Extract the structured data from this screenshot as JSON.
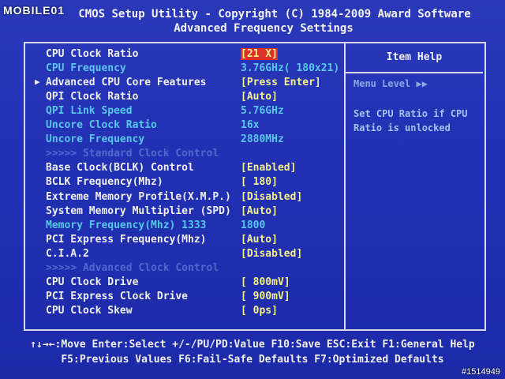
{
  "watermark": "MOBILE01",
  "header": {
    "title": "CMOS Setup Utility - Copyright (C) 1984-2009 Award Software",
    "subtitle": "Advanced Frequency Settings"
  },
  "rows": [
    {
      "label": "CPU Clock Ratio",
      "value": "[21 X]",
      "label_color": "white",
      "value_color": "yellow",
      "highlight": true
    },
    {
      "label": "CPU Frequency",
      "value": "3.76GHz( 180x21)",
      "label_color": "cyan",
      "value_color": "cyan"
    },
    {
      "label": "Advanced CPU Core Features",
      "value": "[Press Enter]",
      "label_color": "white",
      "value_color": "yellow",
      "arrow": true
    },
    {
      "label": "QPI Clock Ratio",
      "value": "[Auto]",
      "label_color": "white",
      "value_color": "yellow"
    },
    {
      "label": "QPI Link Speed",
      "value": "5.76GHz",
      "label_color": "cyan",
      "value_color": "cyan"
    },
    {
      "label": "Uncore Clock Ratio",
      "value": "16x",
      "label_color": "cyan",
      "value_color": "cyan"
    },
    {
      "label": "Uncore Frequency",
      "value": "2880MHz",
      "label_color": "cyan",
      "value_color": "cyan"
    },
    {
      "label": ">>>>>  Standard Clock Control",
      "value": "",
      "label_color": "dim",
      "value_color": "dim"
    },
    {
      "label": "Base Clock(BCLK) Control",
      "value": "[Enabled]",
      "label_color": "white",
      "value_color": "yellow"
    },
    {
      "label": "BCLK Frequency(Mhz)",
      "value": "[ 180]",
      "label_color": "white",
      "value_color": "yellow"
    },
    {
      "label": "Extreme Memory Profile(X.M.P.)",
      "value": "[Disabled]",
      "label_color": "white",
      "value_color": "yellow"
    },
    {
      "label": "System Memory Multiplier (SPD)",
      "value": "[Auto]",
      "label_color": "white",
      "value_color": "yellow"
    },
    {
      "label": "Memory Frequency(Mhz)    1333",
      "value": "1800",
      "label_color": "cyan",
      "value_color": "cyan"
    },
    {
      "label": "PCI Express Frequency(Mhz)",
      "value": "[Auto]",
      "label_color": "white",
      "value_color": "yellow"
    },
    {
      "label": "C.I.A.2",
      "value": "[Disabled]",
      "label_color": "white",
      "value_color": "yellow"
    },
    {
      "label": ">>>>>  Advanced Clock Control",
      "value": "",
      "label_color": "dim",
      "value_color": "dim"
    },
    {
      "label": "CPU Clock Drive",
      "value": "[ 800mV]",
      "label_color": "white",
      "value_color": "yellow"
    },
    {
      "label": "PCI Express Clock Drive",
      "value": "[ 900mV]",
      "label_color": "white",
      "value_color": "yellow"
    },
    {
      "label": "CPU Clock Skew",
      "value": "[   0ps]",
      "label_color": "white",
      "value_color": "yellow"
    }
  ],
  "help": {
    "title": "Item Help",
    "menu_level": "Menu Level   ▶▶",
    "lines": [
      "Set CPU Ratio if CPU",
      "Ratio is unlocked"
    ]
  },
  "footer": {
    "line1": "↑↓→←:Move  Enter:Select  +/-/PU/PD:Value  F10:Save  ESC:Exit  F1:General Help",
    "line2": "F5:Previous Values  F6:Fail-Safe Defaults  F7:Optimized Defaults"
  },
  "stamp": "#1514949",
  "colors": {
    "background": "#1d2fb0",
    "white": "#f0f0f0",
    "yellow": "#f5f08c",
    "cyan": "#57c8e8",
    "dim": "#4e6acd",
    "highlight": "#d8322a"
  }
}
